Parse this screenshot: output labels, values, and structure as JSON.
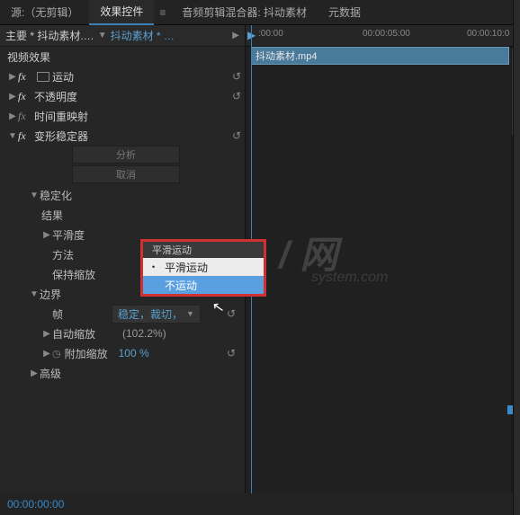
{
  "tabs": {
    "source": "源:（无剪辑）",
    "effects": "效果控件",
    "audio_mixer": "音频剪辑混合器: 抖动素材",
    "metadata": "元数据"
  },
  "crumb": {
    "main": "主要 * 抖动素材.…",
    "after": "抖动素材 * …"
  },
  "section_video": "视频效果",
  "rows": {
    "motion": "运动",
    "opacity": "不透明度",
    "time_remap": "时间重映射",
    "warp_stab": "变形稳定器"
  },
  "buttons": {
    "analyze": "分析",
    "cancel": "取消"
  },
  "stabilize": {
    "group": "稳定化",
    "result": "结果",
    "result_val": "平滑运动",
    "smoothness": "平滑度",
    "method": "方法",
    "keep_scale": "保持缩放"
  },
  "border": {
    "group": "边界",
    "frame": "帧",
    "frame_val": "稳定，裁切，",
    "auto_scale": "自动缩放",
    "auto_scale_val": "(102.2%)",
    "extra_scale": "附加缩放",
    "extra_scale_val": "100 %"
  },
  "advanced": "高级",
  "dropdown": {
    "label": "平滑运动",
    "opt1": "平滑运动",
    "opt2": "不运动"
  },
  "timeline": {
    "t0": ":00:00",
    "t1": "00:00:05:00",
    "t2": "00:00:10:0",
    "clip": "抖动素材.mp4"
  },
  "status_time": "00:00:00:00",
  "watermark1": "/ 网",
  "watermark2": "system.com"
}
